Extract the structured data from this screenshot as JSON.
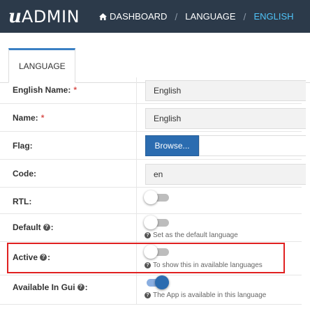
{
  "header": {
    "logo_u": "u",
    "logo_admin": "ADMIN",
    "breadcrumbs": [
      "DASHBOARD",
      "LANGUAGE",
      "ENGLISH"
    ],
    "separator": "/"
  },
  "tab": {
    "label": "LANGUAGE"
  },
  "form": {
    "english_name": {
      "label": "English Name:",
      "required": "*",
      "value": "English"
    },
    "name": {
      "label": "Name:",
      "required": "*",
      "value": "English"
    },
    "flag": {
      "label": "Flag:",
      "button": "Browse..."
    },
    "code": {
      "label": "Code:",
      "value": "en"
    },
    "rtl": {
      "label": "RTL:",
      "enabled": false
    },
    "default": {
      "label": "Default",
      "colon": ":",
      "help": "Set as the default language",
      "enabled": false
    },
    "active": {
      "label": "Active",
      "colon": ":",
      "help": "To show this in available languages",
      "enabled": false
    },
    "available_in_gui": {
      "label": "Available In Gui",
      "colon": ":",
      "help": "The App is available in this language",
      "enabled": true
    }
  },
  "icons": {
    "home": "home-icon",
    "help": "question-circle-icon"
  },
  "colors": {
    "header_bg": "#2c3a4a",
    "active_crumb": "#4fc3f7",
    "primary": "#2b6cb0",
    "required": "#d9534f",
    "highlight": "#e02020"
  }
}
